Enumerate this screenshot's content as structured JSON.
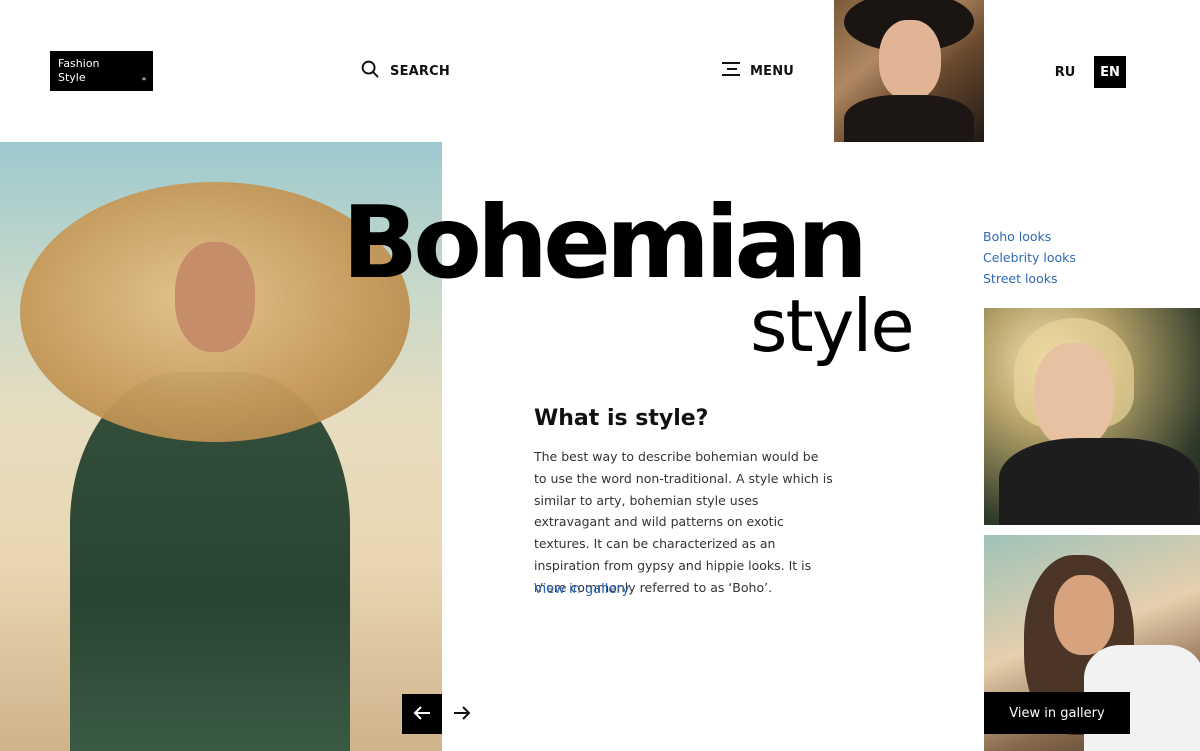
{
  "header": {
    "logo_text": "Fashion\nStyle",
    "logo_star": "*",
    "search_label": "SEARCH",
    "menu_label": "MENU",
    "lang_ru": "RU",
    "lang_en": "EN"
  },
  "hero": {
    "title_main": "Bohemian",
    "title_sub": "style"
  },
  "article": {
    "heading": "What is style?",
    "body": "The best way to describe bohemian would be to use the word non-traditional. A style which is similar to arty, bohemian style uses extravagant and wild patterns on exotic textures. It can be characterized as an inspiration from gypsy and hippie looks. It is more commonly referred to as ‘Boho’.",
    "link": "View in gallery"
  },
  "side_links": [
    "Boho looks",
    "Celebrity looks",
    "Street looks"
  ],
  "gallery_button": "View in gallery",
  "colors": {
    "accent_link": "#2f68b3",
    "black": "#000000"
  },
  "icons": {
    "search": "search-icon",
    "menu": "menu-icon",
    "prev": "arrow-left-icon",
    "next": "arrow-right-icon"
  }
}
